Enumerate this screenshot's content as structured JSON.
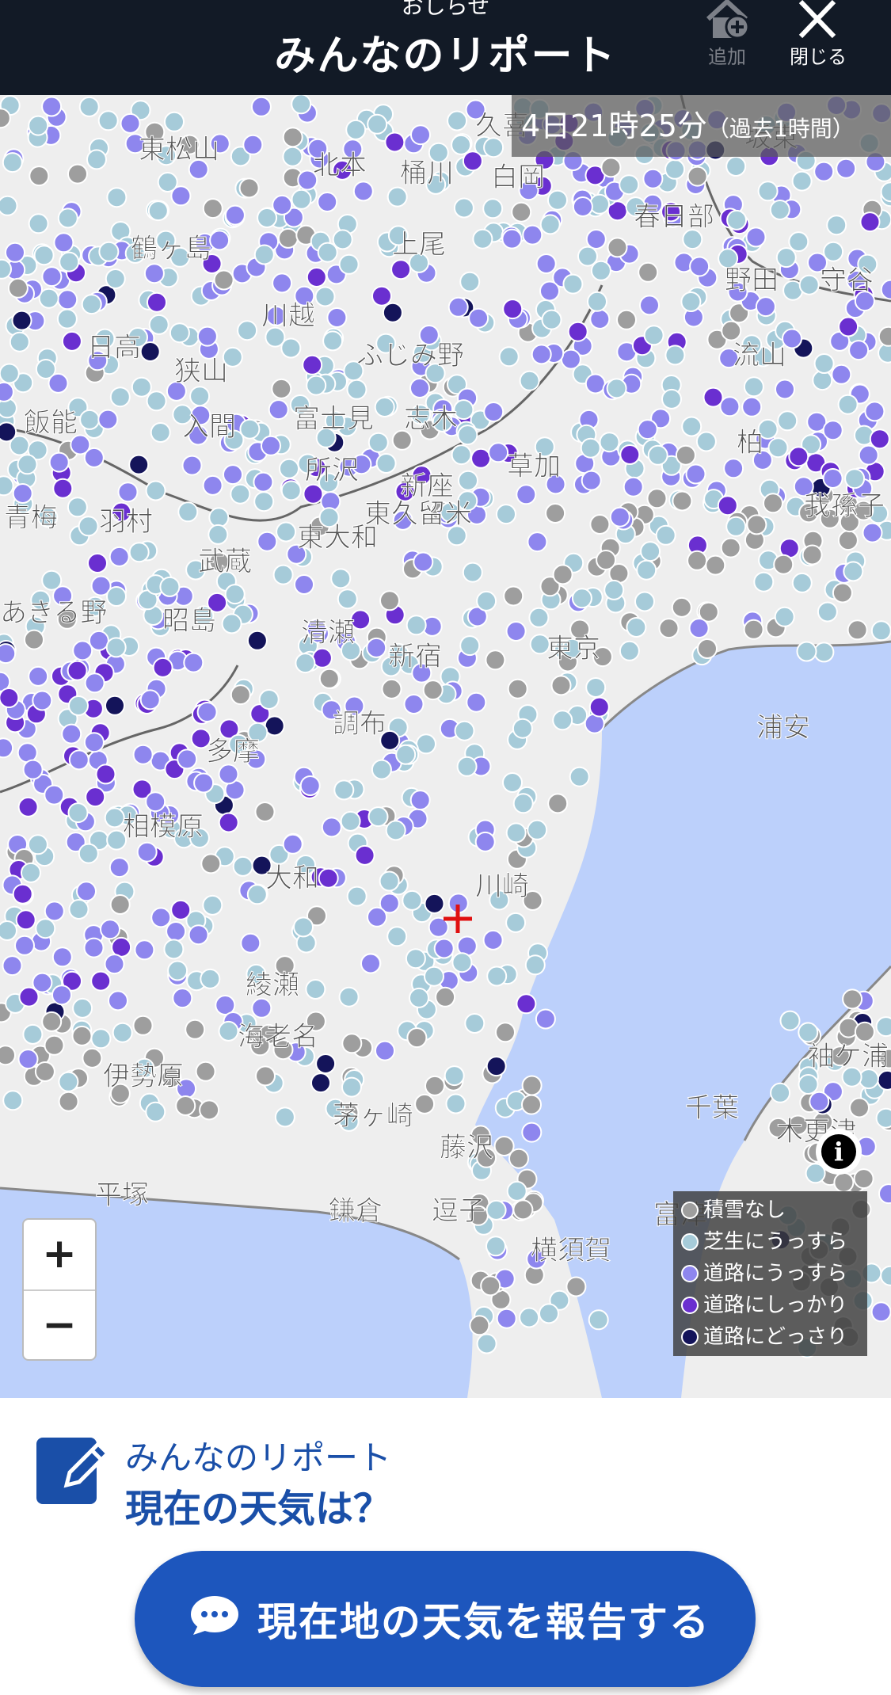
{
  "header": {
    "subtitle": "おしらせ",
    "title": "みんなのリポート",
    "add_label": "追加",
    "close_label": "閉じる",
    "add_icon": "home-plus-icon",
    "close_icon": "close-icon"
  },
  "timestamp": {
    "main": "4日21時25分",
    "note": "（過去1時間）"
  },
  "map": {
    "place_labels": [
      "久喜",
      "東松山",
      "坂東",
      "北本",
      "桶川",
      "白岡",
      "春日部",
      "鶴ヶ島",
      "上尾",
      "野田",
      "守谷",
      "川越",
      "日高",
      "ふじみ野",
      "流山",
      "狭山",
      "富士見",
      "志木",
      "柏",
      "飯能",
      "入間",
      "所沢",
      "新座",
      "草加",
      "我孫子",
      "青梅",
      "羽村",
      "東大和",
      "武蔵",
      "あきる野",
      "昭島",
      "清瀬",
      "東京",
      "調布",
      "浦安",
      "多摩",
      "新宿",
      "相模原",
      "大和",
      "川崎",
      "綾瀬",
      "伊勢原",
      "海老名",
      "袖ケ浦",
      "茅ヶ崎",
      "藤沢",
      "鎌倉",
      "逗子",
      "平塚",
      "横須賀",
      "木更津",
      "富津",
      "千葉",
      "東久留米"
    ],
    "crosshair": "current-location-crosshair"
  },
  "zoom": {
    "in_label": "+",
    "out_label": "−"
  },
  "legend": {
    "items": [
      {
        "label": "積雪なし",
        "color": "#9e9e9e"
      },
      {
        "label": "芝生にうっすら",
        "color": "#a6cbd9"
      },
      {
        "label": "道路にうっすら",
        "color": "#8e86ee"
      },
      {
        "label": "道路にしっかり",
        "color": "#6a2fd0"
      },
      {
        "label": "道路にどっさり",
        "color": "#14145a"
      }
    ]
  },
  "panel": {
    "subtitle": "みんなのリポート",
    "title": "現在の天気は？",
    "button_label": "現在地の天気を報告する"
  },
  "colors": {
    "header_bg": "#121a26",
    "sea": "#bcd0fb",
    "land": "#eeeeee",
    "accent": "#1d56bd"
  }
}
